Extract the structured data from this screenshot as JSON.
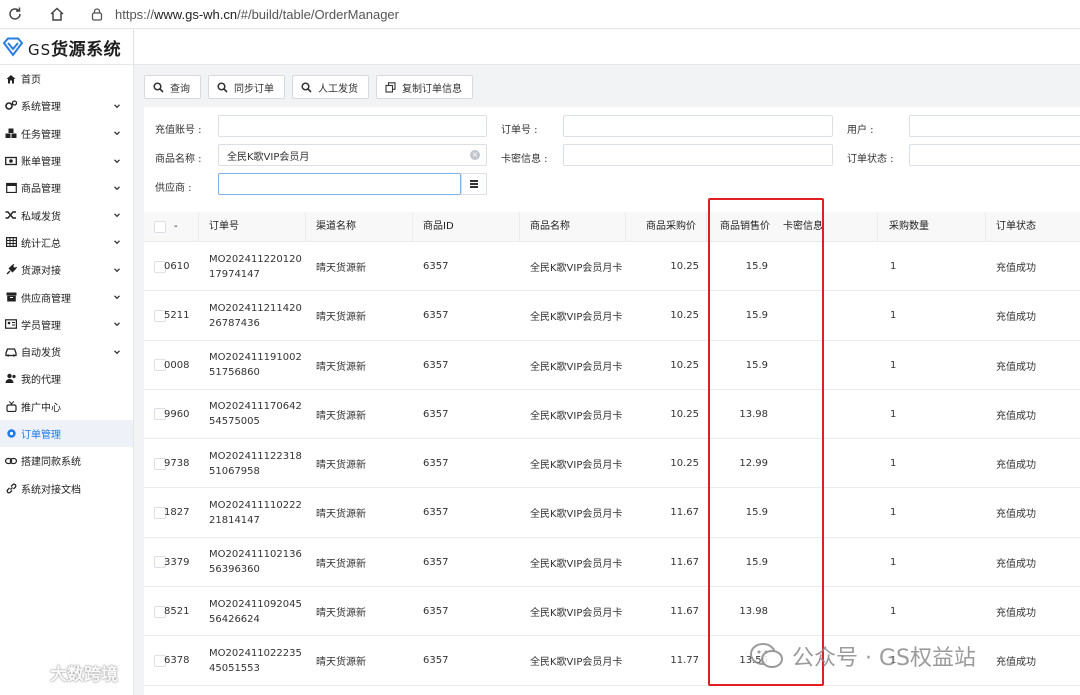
{
  "browser": {
    "url_prefix": "https://",
    "url_host": "www.gs-wh.cn",
    "url_path": "/#/build/table/OrderManager"
  },
  "app": {
    "logo_prefix": "GS",
    "logo_name": "货源系统"
  },
  "sidebar": {
    "items": [
      {
        "label": "首页",
        "icon": "home-icon",
        "chevron": false,
        "active": false
      },
      {
        "label": "系统管理",
        "icon": "gears-icon",
        "chevron": true,
        "active": false
      },
      {
        "label": "任务管理",
        "icon": "cubes-icon",
        "chevron": true,
        "active": false
      },
      {
        "label": "账单管理",
        "icon": "money-icon",
        "chevron": true,
        "active": false
      },
      {
        "label": "商品管理",
        "icon": "calendar-icon",
        "chevron": true,
        "active": false
      },
      {
        "label": "私域发货",
        "icon": "shuffle-icon",
        "chevron": true,
        "active": false
      },
      {
        "label": "统计汇总",
        "icon": "table-icon",
        "chevron": true,
        "active": false
      },
      {
        "label": "货源对接",
        "icon": "plug-icon",
        "chevron": true,
        "active": false
      },
      {
        "label": "供应商管理",
        "icon": "archive-icon",
        "chevron": true,
        "active": false
      },
      {
        "label": "学员管理",
        "icon": "id-card-icon",
        "chevron": true,
        "active": false
      },
      {
        "label": "自动发货",
        "icon": "car-icon",
        "chevron": true,
        "active": false
      },
      {
        "label": "我的代理",
        "icon": "users-icon",
        "chevron": false,
        "active": false
      },
      {
        "label": "推广中心",
        "icon": "gift-icon",
        "chevron": false,
        "active": false
      },
      {
        "label": "订单管理",
        "icon": "gear-icon",
        "chevron": false,
        "active": true
      },
      {
        "label": "搭建同款系统",
        "icon": "chain-icon",
        "chevron": false,
        "active": false
      },
      {
        "label": "系统对接文档",
        "icon": "link-icon",
        "chevron": false,
        "active": false
      }
    ]
  },
  "toolbar": {
    "query_label": "查询",
    "sync_label": "同步订单",
    "manual_label": "人工发货",
    "copy_label": "复制订单信息"
  },
  "filters": {
    "recharge_account_label": "充值账号 :",
    "order_no_label": "订单号 :",
    "user_label": "用户 :",
    "product_name_label": "商品名称 :",
    "product_name_value": "全民K歌VIP会员月",
    "card_info_label": "卡密信息 :",
    "order_status_label": "订单状态 :",
    "supplier_label": "供应商 :"
  },
  "table": {
    "columns": [
      "-",
      "订单号",
      "渠道名称",
      "商品ID",
      "商品名称",
      "商品采购价",
      "商品销售价",
      "卡密信息",
      "采购数量",
      "订单状态"
    ],
    "rows": [
      {
        "id_tail": "0610",
        "order_no": "MO20241122012017974147",
        "channel": "晴天货源新",
        "product_id": "6357",
        "product_name": "全民K歌VIP会员月卡",
        "purchase_price": "10.25",
        "sale_price": "15.9",
        "card_info": "",
        "qty": "1",
        "status": "充值成功"
      },
      {
        "id_tail": "5211",
        "order_no": "MO20241121142026787436",
        "channel": "晴天货源新",
        "product_id": "6357",
        "product_name": "全民K歌VIP会员月卡",
        "purchase_price": "10.25",
        "sale_price": "15.9",
        "card_info": "",
        "qty": "1",
        "status": "充值成功"
      },
      {
        "id_tail": "0008",
        "order_no": "MO20241119100251756860",
        "channel": "晴天货源新",
        "product_id": "6357",
        "product_name": "全民K歌VIP会员月卡",
        "purchase_price": "10.25",
        "sale_price": "15.9",
        "card_info": "",
        "qty": "1",
        "status": "充值成功"
      },
      {
        "id_tail": "9960",
        "order_no": "MO20241117064254575005",
        "channel": "晴天货源新",
        "product_id": "6357",
        "product_name": "全民K歌VIP会员月卡",
        "purchase_price": "10.25",
        "sale_price": "13.98",
        "card_info": "",
        "qty": "1",
        "status": "充值成功"
      },
      {
        "id_tail": "9738",
        "order_no": "MO20241112231851067958",
        "channel": "晴天货源新",
        "product_id": "6357",
        "product_name": "全民K歌VIP会员月卡",
        "purchase_price": "10.25",
        "sale_price": "12.99",
        "card_info": "",
        "qty": "1",
        "status": "充值成功"
      },
      {
        "id_tail": "1827",
        "order_no": "MO20241111022221814147",
        "channel": "晴天货源新",
        "product_id": "6357",
        "product_name": "全民K歌VIP会员月卡",
        "purchase_price": "11.67",
        "sale_price": "15.9",
        "card_info": "",
        "qty": "1",
        "status": "充值成功"
      },
      {
        "id_tail": "3379",
        "order_no": "MO20241110213656396360",
        "channel": "晴天货源新",
        "product_id": "6357",
        "product_name": "全民K歌VIP会员月卡",
        "purchase_price": "11.67",
        "sale_price": "15.9",
        "card_info": "",
        "qty": "1",
        "status": "充值成功"
      },
      {
        "id_tail": "8521",
        "order_no": "MO20241109204556426624",
        "channel": "晴天货源新",
        "product_id": "6357",
        "product_name": "全民K歌VIP会员月卡",
        "purchase_price": "11.67",
        "sale_price": "13.98",
        "card_info": "",
        "qty": "1",
        "status": "充值成功"
      },
      {
        "id_tail": "6378",
        "order_no": "MO20241102223545051553",
        "channel": "晴天货源新",
        "product_id": "6357",
        "product_name": "全民K歌VIP会员月卡",
        "purchase_price": "11.77",
        "sale_price": "13.56",
        "card_info": "",
        "qty": "1",
        "status": "充值成功"
      }
    ]
  },
  "watermarks": {
    "left": "大数跨境",
    "right": "公众号 · GS权益站"
  },
  "colors": {
    "accent": "#1e7be8",
    "annotation": "#e02020"
  }
}
